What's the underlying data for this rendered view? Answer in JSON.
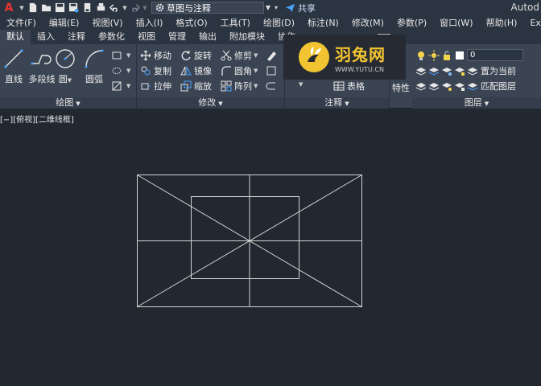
{
  "app": {
    "logo_letter": "A",
    "title_fragment": "Autod"
  },
  "quick_access": {
    "workspace": "草图与注释",
    "share_label": "共享"
  },
  "menu": [
    "文件(F)",
    "编辑(E)",
    "视图(V)",
    "插入(I)",
    "格式(O)",
    "工具(T)",
    "绘图(D)",
    "标注(N)",
    "修改(M)",
    "参数(P)",
    "窗口(W)",
    "帮助(H)",
    "Exp"
  ],
  "tabs": [
    "默认",
    "插入",
    "注释",
    "参数化",
    "视图",
    "管理",
    "输出",
    "附加模块",
    "协作"
  ],
  "active_tab": "默认",
  "ribbon": {
    "draw": {
      "title": "绘图",
      "line": "直线",
      "polyline": "多段线",
      "circle": "圆",
      "arc": "圆弧"
    },
    "modify": {
      "title": "修改",
      "move": "移动",
      "rotate": "旋转",
      "trim": "修剪",
      "copy": "复制",
      "mirror": "镜像",
      "fillet": "圆角",
      "stretch": "拉伸",
      "scale": "缩放",
      "array": "阵列"
    },
    "annotation": {
      "title": "注释",
      "table": "表格",
      "properties_fragment": "特性"
    },
    "layers": {
      "title": "图层",
      "current_layer": "0",
      "set_current": "置为当前",
      "match_layer": "匹配图层"
    }
  },
  "watermark": {
    "name": "羽兔网",
    "url": "WWW.YUTU.CN"
  },
  "viewport": {
    "label": "[−][俯视][二维线框]"
  },
  "colors": {
    "background": "#212830",
    "ribbon": "#3b4453",
    "menubar": "#2b3441",
    "drawing_lines": "#d4d4d4",
    "watermark_accent": "#f3c431"
  }
}
